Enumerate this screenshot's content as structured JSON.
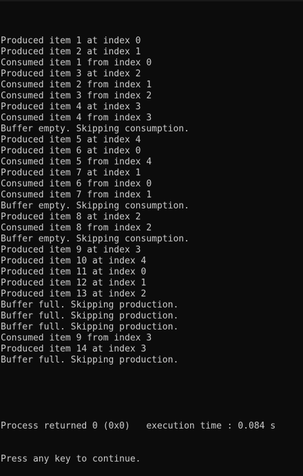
{
  "console": {
    "lines": [
      "Produced item 1 at index 0",
      "Produced item 2 at index 1",
      "Consumed item 1 from index 0",
      "Produced item 3 at index 2",
      "Consumed item 2 from index 1",
      "Consumed item 3 from index 2",
      "Produced item 4 at index 3",
      "Consumed item 4 from index 3",
      "Buffer empty. Skipping consumption.",
      "Produced item 5 at index 4",
      "Produced item 6 at index 0",
      "Consumed item 5 from index 4",
      "Produced item 7 at index 1",
      "Consumed item 6 from index 0",
      "Consumed item 7 from index 1",
      "Buffer empty. Skipping consumption.",
      "Produced item 8 at index 2",
      "Consumed item 8 from index 2",
      "Buffer empty. Skipping consumption.",
      "Produced item 9 at index 3",
      "Produced item 10 at index 4",
      "Produced item 11 at index 0",
      "Produced item 12 at index 1",
      "Produced item 13 at index 2",
      "Buffer full. Skipping production.",
      "Buffer full. Skipping production.",
      "Buffer full. Skipping production.",
      "Consumed item 9 from index 3",
      "Produced item 14 at index 3",
      "Buffer full. Skipping production."
    ],
    "process_returned": "Process returned 0 (0x0)   execution time : 0.084 s",
    "press_any_key": "Press any key to continue."
  },
  "colors": {
    "background": "#0c0c0c",
    "text": "#cccccc"
  }
}
